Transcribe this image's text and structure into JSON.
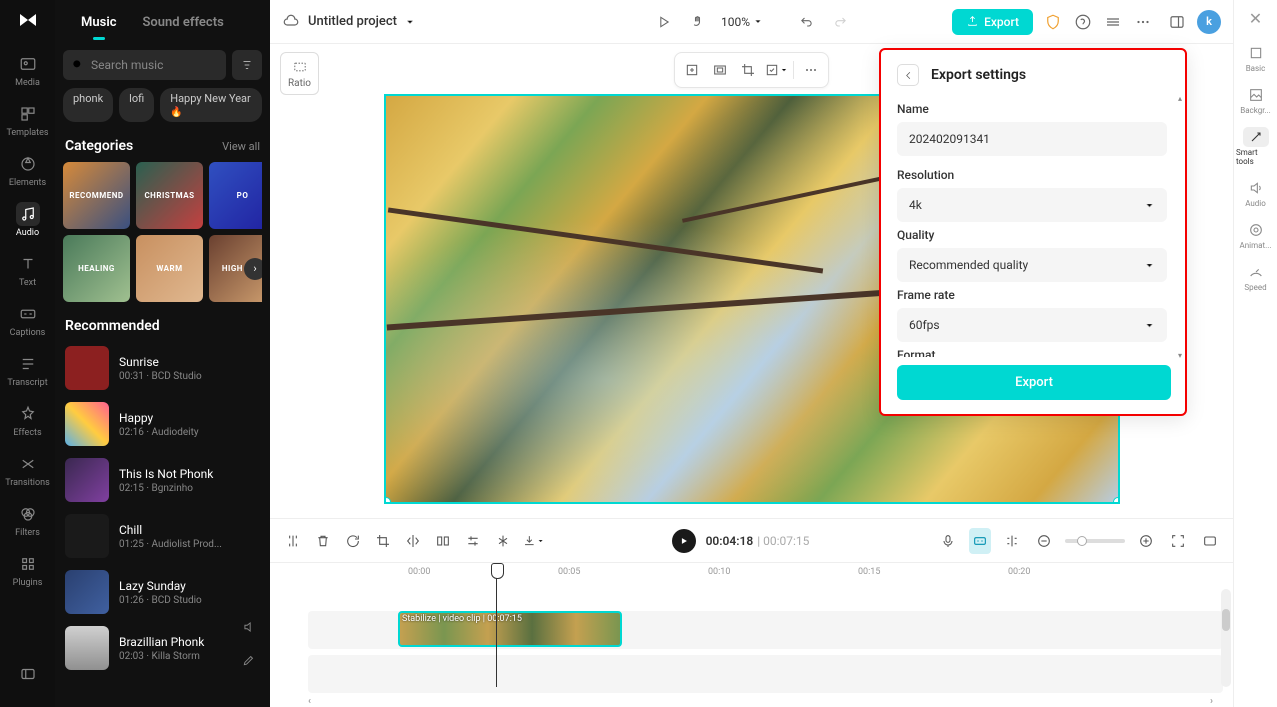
{
  "leftNav": {
    "items": [
      {
        "label": "Media"
      },
      {
        "label": "Templates"
      },
      {
        "label": "Elements"
      },
      {
        "label": "Audio"
      },
      {
        "label": "Text"
      },
      {
        "label": "Captions"
      },
      {
        "label": "Transcript"
      },
      {
        "label": "Effects"
      },
      {
        "label": "Transitions"
      },
      {
        "label": "Filters"
      },
      {
        "label": "Plugins"
      }
    ],
    "activeIndex": 3
  },
  "audioPanel": {
    "tabs": {
      "music": "Music",
      "sfx": "Sound effects"
    },
    "searchPlaceholder": "Search music",
    "chips": [
      "phonk",
      "lofi",
      "Happy New Year"
    ],
    "categories": {
      "title": "Categories",
      "viewAll": "View all",
      "cards": [
        "RECOMMEND",
        "CHRISTMAS",
        "PO",
        "HEALING",
        "WARM",
        "HIGH TEM"
      ]
    },
    "recommended": {
      "title": "Recommended",
      "tracks": [
        {
          "title": "Sunrise",
          "meta": "00:31 · BCD Studio",
          "color": "#8c2020"
        },
        {
          "title": "Happy",
          "meta": "02:16 · Audiodeity",
          "color": "#5ab0e8"
        },
        {
          "title": "This Is Not Phonk",
          "meta": "02:15 · Bgnzinho",
          "color": "#3a2850"
        },
        {
          "title": "Chill",
          "meta": "01:25 · Audiolist Prod...",
          "color": "#1a1a1a"
        },
        {
          "title": "Lazy Sunday",
          "meta": "01:26 · BCD Studio",
          "color": "#2a4070"
        },
        {
          "title": "Brazillian Phonk",
          "meta": "02:03 · Killa Storm",
          "color": "#c0c0c0"
        }
      ]
    }
  },
  "topBar": {
    "projectTitle": "Untitled project",
    "zoom": "100%",
    "exportLabel": "Export",
    "avatarLetter": "k"
  },
  "ratio": "Ratio",
  "timeline": {
    "currentTime": "00:04:18",
    "duration": "00:07:15",
    "clipLabel": "Stabilize | video clip | 00:07:15",
    "ruler": [
      "00:00",
      "00:05",
      "00:10",
      "00:15",
      "00:20"
    ]
  },
  "rightPanel": {
    "items": [
      "Basic",
      "Backgr...",
      "Smart tools",
      "Audio",
      "Animat...",
      "Speed"
    ],
    "activeIndex": 2
  },
  "exportModal": {
    "title": "Export settings",
    "name": {
      "label": "Name",
      "value": "202402091341"
    },
    "resolution": {
      "label": "Resolution",
      "value": "4k"
    },
    "quality": {
      "label": "Quality",
      "value": "Recommended quality"
    },
    "frameRate": {
      "label": "Frame rate",
      "value": "60fps"
    },
    "format": {
      "label": "Format"
    },
    "exportBtn": "Export"
  }
}
